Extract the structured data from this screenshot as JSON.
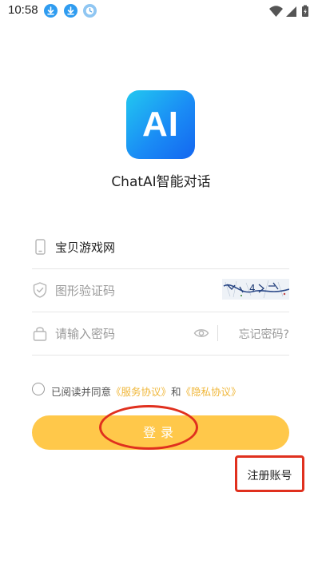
{
  "status_bar": {
    "time": "10:58",
    "notification_icons": [
      "download-icon",
      "download-icon",
      "clock-icon"
    ],
    "right_icons": [
      "wifi-icon",
      "signal-icon",
      "battery-charging-icon"
    ]
  },
  "app": {
    "logo_text": "AI",
    "name": "ChatAI智能对话"
  },
  "form": {
    "username": {
      "icon": "phone-icon",
      "value": "宝贝游戏网"
    },
    "captcha": {
      "icon": "shield-check-icon",
      "placeholder": "图形验证码",
      "captcha_text": "4"
    },
    "password": {
      "icon": "lock-icon",
      "placeholder": "请输入密码",
      "forgot_label": "忘记密码?"
    }
  },
  "agreement": {
    "prefix": "已阅读并同意",
    "service_link": "《服务协议》",
    "conjunction": "和",
    "privacy_link": "《隐私协议》"
  },
  "login_button_label": "登录",
  "register_label": "注册账号",
  "colors": {
    "accent": "#ffc84a",
    "link": "#f0b73a",
    "annotation": "#e0301e",
    "logo_gradient_start": "#22c8f0",
    "logo_gradient_end": "#1466f0"
  }
}
